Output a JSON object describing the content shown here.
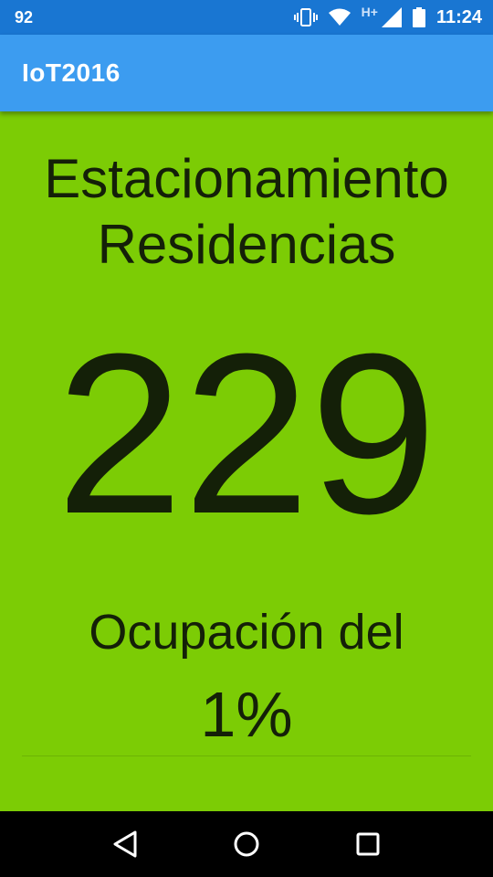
{
  "status_bar": {
    "left_text": "92",
    "network_label": "H+",
    "time": "11:24"
  },
  "app_bar": {
    "title": "IoT2016"
  },
  "main": {
    "heading_line1": "Estacionamiento",
    "heading_line2": "Residencias",
    "count": "229",
    "occupancy_label": "Ocupación del",
    "occupancy_value": "1%"
  },
  "colors": {
    "status_bar": "#1976d2",
    "app_bar": "#3c9cf0",
    "content_background": "#7ccc05",
    "text": "#142008"
  },
  "icons": {
    "status": [
      "vibrate-icon",
      "wifi-icon",
      "signal-icon",
      "battery-icon"
    ],
    "nav": [
      "back-icon",
      "home-icon",
      "recents-icon"
    ]
  }
}
